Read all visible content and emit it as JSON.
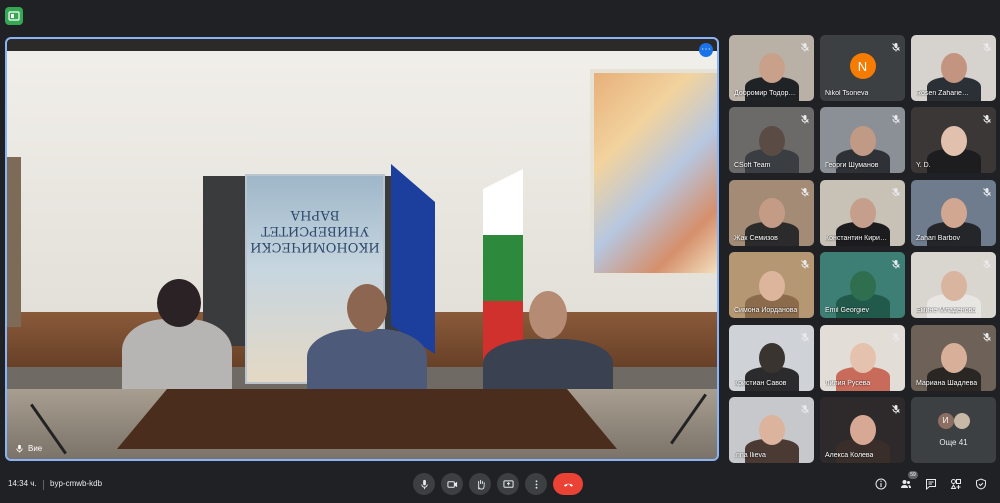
{
  "main": {
    "self_label": "Вие",
    "banner_text": "ИКОНОМИЧЕСКИ УНИВЕРСИТЕТ ВАРНА"
  },
  "participants": [
    {
      "name": "Добромир Тодор…",
      "muted": true,
      "bg": "#b9b0a6",
      "skin": "#c9a18a",
      "shirt": "#1f2326"
    },
    {
      "name": "Nikol Tsoneva",
      "muted": true,
      "avatar": "N",
      "avatar_color": "#f57c00"
    },
    {
      "name": "Rosen Zaharie…",
      "muted": true,
      "bg": "#d6d3cf",
      "skin": "#c39580",
      "shirt": "#2b2f36"
    },
    {
      "name": "CSoft Team",
      "muted": true,
      "bg": "#6b6a68",
      "skin": "#5a4c44",
      "shirt": "#3a3d42"
    },
    {
      "name": "Георги Шуманов",
      "muted": true,
      "bg": "#8b8f96",
      "skin": "#c19a86",
      "shirt": "#2e3135"
    },
    {
      "name": "Y. D.",
      "muted": true,
      "bg": "#3a3736",
      "skin": "#e1c0ad",
      "shirt": "#1d1d1f"
    },
    {
      "name": "Жак Семизов",
      "muted": true,
      "bg": "#a38b75",
      "skin": "#c49c86",
      "shirt": "#2b2b2b"
    },
    {
      "name": "Константин Кири…",
      "muted": true,
      "bg": "#c7c1b6",
      "skin": "#c59f8b",
      "shirt": "#1c1c1e"
    },
    {
      "name": "Zahari Barbov",
      "muted": true,
      "bg": "#6f7c8d",
      "skin": "#d1a791",
      "shirt": "#252629"
    },
    {
      "name": "Симона Йорданова",
      "muted": true,
      "bg": "#b59873",
      "skin": "#ddb59d",
      "shirt": "#8b6b4b"
    },
    {
      "name": "Emil Georgiev",
      "muted": true,
      "bg": "#3d7f74",
      "skin": "#2f6f4f",
      "shirt": "#215a4a"
    },
    {
      "name": "Емине Младенова",
      "muted": true,
      "bg": "#d9d5cf",
      "skin": "#d9b5a0",
      "shirt": "#e8e6e3"
    },
    {
      "name": "Кристиан Савов",
      "muted": true,
      "bg": "#cfd2d6",
      "skin": "#3a3431",
      "shirt": "#2b2b2d"
    },
    {
      "name": "Лилия Русева",
      "muted": true,
      "bg": "#e2ddd6",
      "skin": "#e4c2ad",
      "shirt": "#c96b5b"
    },
    {
      "name": "Мариана Шадлева",
      "muted": true,
      "bg": "#6e6157",
      "skin": "#d8b09a",
      "shirt": "#2a2624"
    },
    {
      "name": "Irina Ilieva",
      "muted": true,
      "bg": "#c6c8cc",
      "skin": "#dcb39c",
      "shirt": "#4b3a33"
    },
    {
      "name": "Алекса Колева",
      "muted": true,
      "bg": "#2e2a2c",
      "skin": "#d7a994",
      "shirt": "#3a2e2a"
    }
  ],
  "others": {
    "label": "Още 41",
    "avatars": [
      {
        "letter": "И",
        "color": "#8d6e63"
      },
      {
        "letter": "",
        "color": "#c7b9a6"
      }
    ]
  },
  "bottombar": {
    "time": "14:34 ч.",
    "meeting_code": "byp-cmwb-kdb",
    "people_count": "59"
  },
  "colors": {
    "background": "#202124",
    "active_border": "#8ab4f8",
    "end_call": "#ea4335"
  }
}
